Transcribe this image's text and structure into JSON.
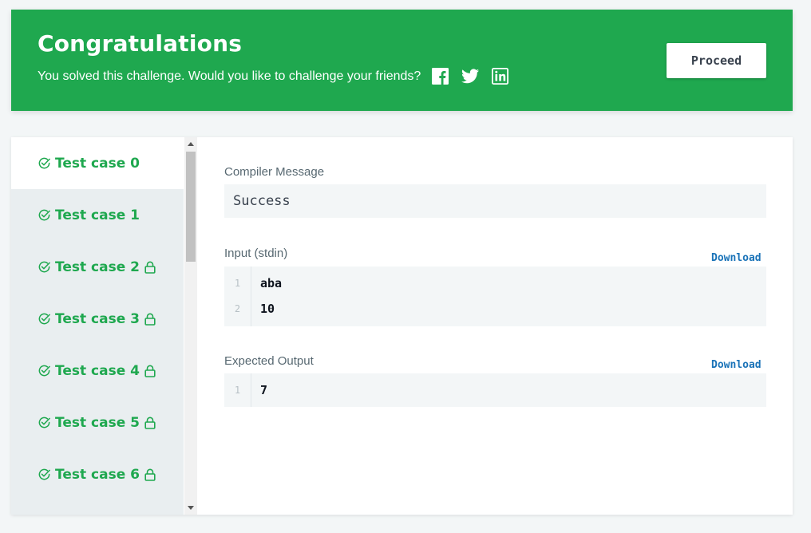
{
  "banner": {
    "title": "Congratulations",
    "subtitle": "You solved this challenge. Would you like to challenge your friends?",
    "social_icons": [
      "facebook-icon",
      "twitter-icon",
      "linkedin-icon"
    ],
    "proceed_label": "Proceed",
    "color": "#1fa84f"
  },
  "sidebar": {
    "items": [
      {
        "label": "Test case 0",
        "locked": false,
        "active": true
      },
      {
        "label": "Test case 1",
        "locked": false,
        "active": false
      },
      {
        "label": "Test case 2",
        "locked": true,
        "active": false
      },
      {
        "label": "Test case 3",
        "locked": true,
        "active": false
      },
      {
        "label": "Test case 4",
        "locked": true,
        "active": false
      },
      {
        "label": "Test case 5",
        "locked": true,
        "active": false
      },
      {
        "label": "Test case 6",
        "locked": true,
        "active": false
      }
    ]
  },
  "main": {
    "compiler": {
      "label": "Compiler Message",
      "message": "Success"
    },
    "input": {
      "label": "Input (stdin)",
      "download": "Download",
      "lines": [
        {
          "n": "1",
          "text": "aba"
        },
        {
          "n": "2",
          "text": "10"
        }
      ]
    },
    "expected": {
      "label": "Expected Output",
      "download": "Download",
      "lines": [
        {
          "n": "1",
          "text": "7"
        }
      ]
    }
  }
}
